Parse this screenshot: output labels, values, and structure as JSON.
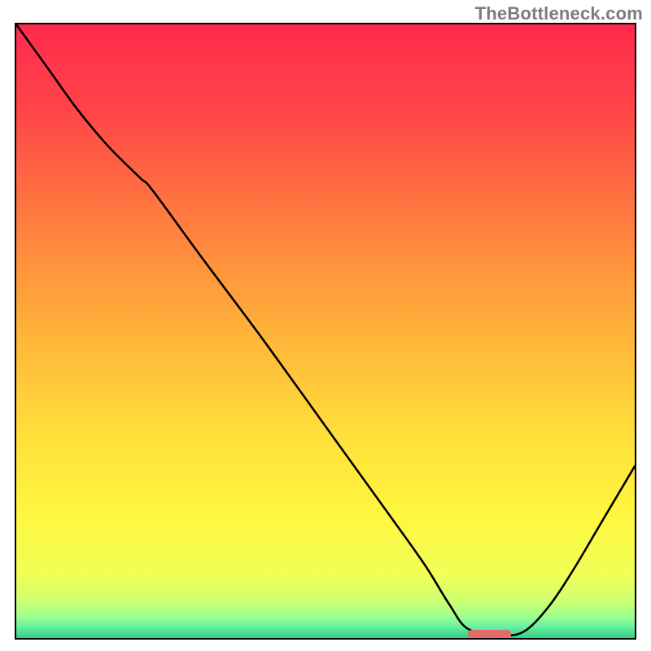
{
  "meta": {
    "watermark": "TheBottleneck.com",
    "source_site": "TheBottleneck.com"
  },
  "chart_data": {
    "type": "line",
    "title": "",
    "xlabel": "",
    "ylabel": "",
    "xlim": [
      0,
      100
    ],
    "ylim": [
      0,
      100
    ],
    "x_is_normalized_percent": true,
    "y_is_bottleneck_percent": true,
    "note": "Axis units are not shown in the image; x is a normalized 0–100 position across the plot, y is read as percent (0 at bottom, 100 at top). Curve points below are estimated from pixel positions.",
    "series": [
      {
        "name": "bottleneck-curve",
        "x": [
          0.0,
          5.0,
          10.0,
          15.0,
          20.0,
          22.0,
          30.0,
          40.0,
          50.0,
          60.0,
          66.0,
          70.0,
          73.0,
          78.0,
          82.0,
          86.0,
          90.0,
          95.0,
          100.0
        ],
        "y": [
          100.0,
          93.0,
          86.0,
          80.0,
          75.0,
          73.0,
          62.0,
          48.5,
          34.5,
          20.5,
          12.0,
          5.5,
          1.5,
          0.5,
          1.0,
          5.0,
          11.0,
          19.5,
          28.0
        ]
      }
    ],
    "minimum_marker": {
      "x_range": [
        73.0,
        80.0
      ],
      "y": 0.6,
      "color": "#e26b6b"
    },
    "background_gradient_stops": [
      {
        "pct": 0,
        "color": "#ff2a4d"
      },
      {
        "pct": 14,
        "color": "#ff4549"
      },
      {
        "pct": 32,
        "color": "#ff7d3f"
      },
      {
        "pct": 50,
        "color": "#ffb23a"
      },
      {
        "pct": 66,
        "color": "#ffdd3a"
      },
      {
        "pct": 80,
        "color": "#fff73f"
      },
      {
        "pct": 90,
        "color": "#f0ff58"
      },
      {
        "pct": 94,
        "color": "#cdff72"
      },
      {
        "pct": 96.5,
        "color": "#9dff8c"
      },
      {
        "pct": 98,
        "color": "#6cf3a0"
      },
      {
        "pct": 100,
        "color": "#33d08a"
      }
    ]
  }
}
